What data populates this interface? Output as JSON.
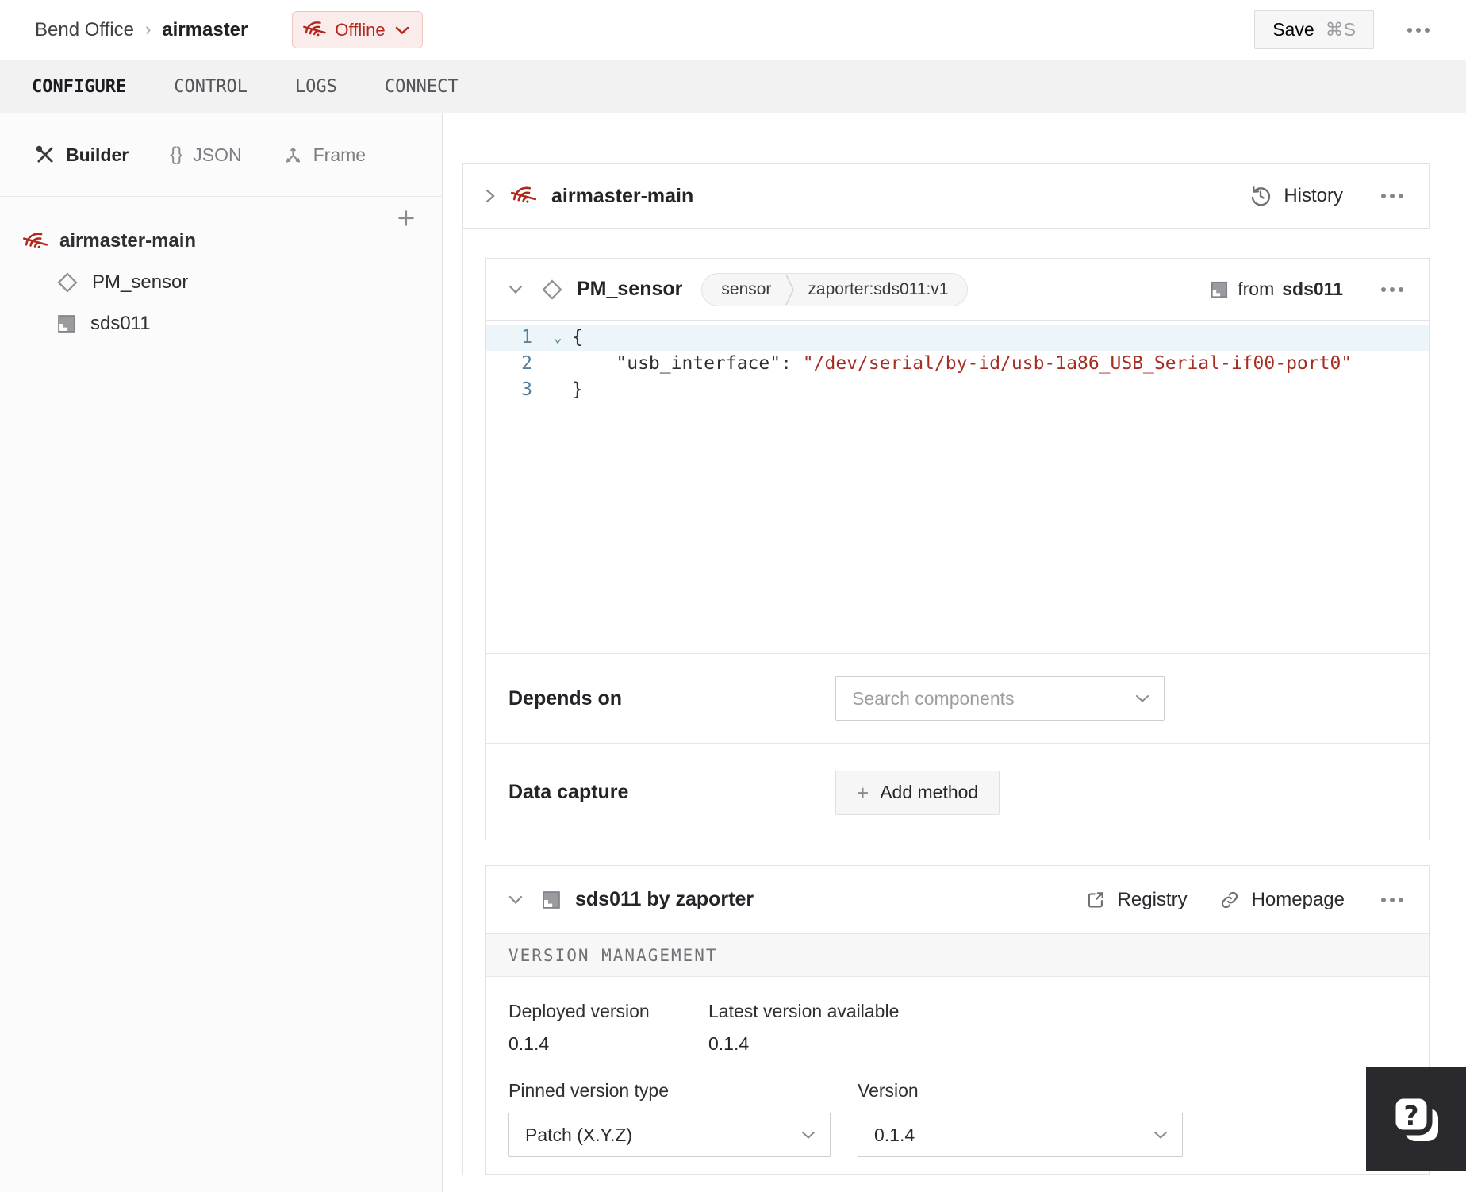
{
  "header": {
    "breadcrumb": {
      "org": "Bend Office",
      "separator": "›",
      "machine": "airmaster"
    },
    "status_badge": {
      "label": "Offline",
      "color": "#b3261c",
      "background": "#faecea"
    },
    "save_button": {
      "label": "Save",
      "shortcut": "⌘S"
    }
  },
  "tabs": [
    {
      "label": "CONFIGURE",
      "active": true
    },
    {
      "label": "CONTROL",
      "active": false
    },
    {
      "label": "LOGS",
      "active": false
    },
    {
      "label": "CONNECT",
      "active": false
    }
  ],
  "sidebar": {
    "modes": [
      {
        "label": "Builder",
        "active": true
      },
      {
        "label": "JSON",
        "icon_glyph": "{}",
        "active": false
      },
      {
        "label": "Frame",
        "active": false
      }
    ],
    "tree": [
      {
        "label": "airmaster-main",
        "type": "machine-part",
        "status": "offline"
      },
      {
        "label": "PM_sensor",
        "type": "component"
      },
      {
        "label": "sds011",
        "type": "module"
      }
    ]
  },
  "main": {
    "part_card": {
      "title": "airmaster-main",
      "history_label": "History"
    },
    "component_card": {
      "title": "PM_sensor",
      "type_badge": "sensor",
      "model_badge": "zaporter:sds011:v1",
      "from_prefix": "from",
      "from_module": "sds011",
      "code_lines": [
        {
          "num": "1",
          "code": "{"
        },
        {
          "num": "2",
          "key": "    \"usb_interface\": ",
          "value": "\"/dev/serial/by-id/usb-1a86_USB_Serial-if00-port0\""
        },
        {
          "num": "3",
          "code": "}"
        }
      ],
      "depends_on": {
        "label": "Depends on",
        "placeholder": "Search components"
      },
      "data_capture": {
        "label": "Data capture",
        "add_button": "Add method"
      }
    },
    "module_card": {
      "title": "sds011 by zaporter",
      "registry_label": "Registry",
      "homepage_label": "Homepage",
      "section_title": "VERSION MANAGEMENT",
      "deployed_version": {
        "label": "Deployed version",
        "value": "0.1.4"
      },
      "latest_version": {
        "label": "Latest version available",
        "value": "0.1.4"
      },
      "pinned_type": {
        "label": "Pinned version type",
        "value": "Patch (X.Y.Z)"
      },
      "version": {
        "label": "Version",
        "value": "0.1.4"
      }
    }
  }
}
